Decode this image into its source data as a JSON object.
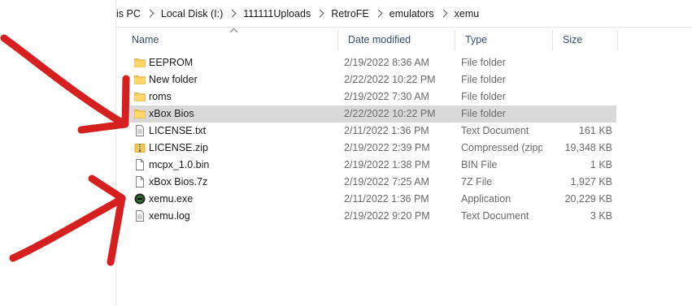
{
  "breadcrumb": [
    "is PC",
    "Local Disk (I:)",
    "111111Uploads",
    "RetroFE",
    "emulators",
    "xemu"
  ],
  "columns": {
    "name": "Name",
    "date": "Date modified",
    "type": "Type",
    "size": "Size"
  },
  "files": [
    {
      "name": "EEPROM",
      "date": "2/19/2022 8:36 AM",
      "type": "File folder",
      "size": "",
      "icon": "folder-icon"
    },
    {
      "name": "New folder",
      "date": "2/22/2022 10:22 PM",
      "type": "File folder",
      "size": "",
      "icon": "folder-icon"
    },
    {
      "name": "roms",
      "date": "2/19/2022 7:30 AM",
      "type": "File folder",
      "size": "",
      "icon": "folder-icon"
    },
    {
      "name": "xBox Bios",
      "date": "2/22/2022 10:22 PM",
      "type": "File folder",
      "size": "",
      "icon": "folder-icon",
      "selected": true
    },
    {
      "name": "LICENSE.txt",
      "date": "2/11/2022 1:36 PM",
      "type": "Text Document",
      "size": "161 KB",
      "icon": "text-document-icon"
    },
    {
      "name": "LICENSE.zip",
      "date": "2/19/2022 2:39 PM",
      "type": "Compressed (zipp...",
      "size": "19,348 KB",
      "icon": "zip-folder-icon"
    },
    {
      "name": "mcpx_1.0.bin",
      "date": "2/19/2022 1:38 PM",
      "type": "BIN File",
      "size": "1 KB",
      "icon": "file-icon"
    },
    {
      "name": "xBox Bios.7z",
      "date": "2/19/2022 7:25 AM",
      "type": "7Z File",
      "size": "1,927 KB",
      "icon": "file-icon"
    },
    {
      "name": "xemu.exe",
      "date": "2/11/2022 1:36 PM",
      "type": "Application",
      "size": "20,229 KB",
      "icon": "xemu-app-icon"
    },
    {
      "name": "xemu.log",
      "date": "2/19/2022 9:20 PM",
      "type": "Text Document",
      "size": "3 KB",
      "icon": "text-document-icon"
    }
  ],
  "colors": {
    "arrow": "#d61f1f",
    "selection": "#d9d9d9",
    "folder": "#f3c74b"
  }
}
